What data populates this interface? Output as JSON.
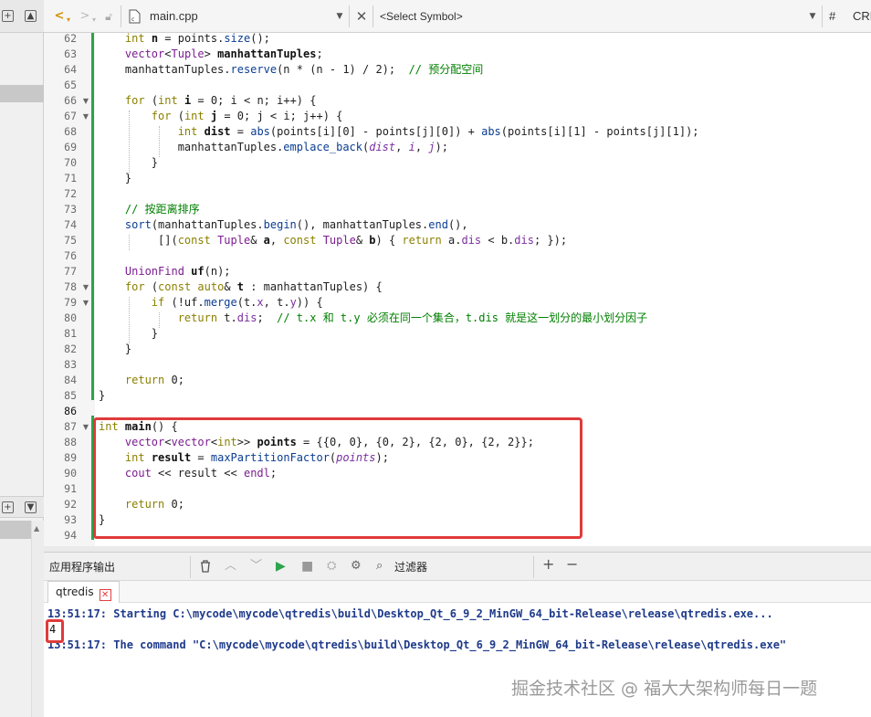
{
  "editor": {
    "file_name": "main.cpp",
    "symbol_placeholder": "<Select Symbol>",
    "hash_label": "#",
    "line_ending": "CRL"
  },
  "code": {
    "lines": [
      {
        "n": "62",
        "html": "    <span class='kw'>int</span> <span class='id'>n</span> = points.<span class='fn'>size</span>();"
      },
      {
        "n": "63",
        "html": "    <span class='ty'>vector</span>&lt;<span class='ty'>Tuple</span>&gt; <span class='id'>manhattanTuples</span>;"
      },
      {
        "n": "64",
        "html": "    manhattanTuples.<span class='fn'>reserve</span>(n * (n - 1) / 2);  <span class='cm'>// 预分配空间</span>"
      },
      {
        "n": "65",
        "html": ""
      },
      {
        "n": "66",
        "html": "    <span class='kw'>for</span> (<span class='kw'>int</span> <span class='id'>i</span> = 0; i &lt; n; i++) {"
      },
      {
        "n": "67",
        "html": "        <span class='kw'>for</span> (<span class='kw'>int</span> <span class='id'>j</span> = 0; j &lt; i; j++) {"
      },
      {
        "n": "68",
        "html": "            <span class='kw'>int</span> <span class='id'>dist</span> = <span class='fn'>abs</span>(points[i][0] - points[j][0]) + <span class='fn'>abs</span>(points[i][1] - points[j][1]);"
      },
      {
        "n": "69",
        "html": "            manhattanTuples.<span class='fn'>emplace_back</span>(<span class='it'>dist</span>, <span class='it'>i</span>, <span class='it'>j</span>);"
      },
      {
        "n": "70",
        "html": "        }"
      },
      {
        "n": "71",
        "html": "    }"
      },
      {
        "n": "72",
        "html": ""
      },
      {
        "n": "73",
        "html": "    <span class='cm'>// 按距离排序</span>"
      },
      {
        "n": "74",
        "html": "    <span class='fn'>sort</span>(manhattanTuples.<span class='fn'>begin</span>(), manhattanTuples.<span class='fn'>end</span>(),"
      },
      {
        "n": "75",
        "html": "         [](<span class='kw'>const</span> <span class='ty'>Tuple</span>&amp; <span class='id'>a</span>, <span class='kw'>const</span> <span class='ty'>Tuple</span>&amp; <span class='id'>b</span>) { <span class='kw'>return</span> a.<span class='pr'>dis</span> &lt; b.<span class='pr'>dis</span>; });"
      },
      {
        "n": "76",
        "html": ""
      },
      {
        "n": "77",
        "html": "    <span class='ty'>UnionFind</span> <span class='id'>uf</span>(n);"
      },
      {
        "n": "78",
        "html": "    <span class='kw'>for</span> (<span class='kw'>const</span> <span class='kw'>auto</span>&amp; <span class='id'>t</span> : manhattanTuples) {"
      },
      {
        "n": "79",
        "html": "        <span class='kw'>if</span> (!uf.<span class='fn'>merge</span>(t.<span class='pr'>x</span>, t.<span class='pr'>y</span>)) {"
      },
      {
        "n": "80",
        "html": "            <span class='kw'>return</span> t.<span class='pr'>dis</span>;  <span class='cm'>// t.x 和 t.y 必须在同一个集合，t.dis 就是这一划分的最小划分因子</span>"
      },
      {
        "n": "81",
        "html": "        }"
      },
      {
        "n": "82",
        "html": "    }"
      },
      {
        "n": "83",
        "html": ""
      },
      {
        "n": "84",
        "html": "    <span class='kw'>return</span> 0;"
      },
      {
        "n": "85",
        "html": "}"
      },
      {
        "n": "86",
        "html": ""
      },
      {
        "n": "87",
        "html": "<span class='kw'>int</span> <span class='id'>main</span>() {"
      },
      {
        "n": "88",
        "html": "    <span class='ty'>vector</span>&lt;<span class='ty'>vector</span>&lt;<span class='kw'>int</span>&gt;&gt; <span class='id'>points</span> = {{0, 0}, {0, 2}, {2, 0}, {2, 2}};"
      },
      {
        "n": "89",
        "html": "    <span class='kw'>int</span> <span class='id'>result</span> = <span class='fn'>maxPartitionFactor</span>(<span class='it'>points</span>);"
      },
      {
        "n": "90",
        "html": "    <span class='ty'>cout</span> &lt;&lt; result &lt;&lt; <span class='ty'>endl</span>;"
      },
      {
        "n": "91",
        "html": ""
      },
      {
        "n": "92",
        "html": "    <span class='kw'>return</span> 0;"
      },
      {
        "n": "93",
        "html": "}"
      },
      {
        "n": "94",
        "html": ""
      }
    ]
  },
  "output": {
    "pane_title": "应用程序输出",
    "filter_label": "过滤器",
    "tab_label": "qtredis",
    "line1": "13:51:17: Starting C:\\mycode\\mycode\\qtredis\\build\\Desktop_Qt_6_9_2_MinGW_64_bit-Release\\release\\qtredis.exe...",
    "result": "4",
    "line2": "13:51:17: The command \"C:\\mycode\\mycode\\qtredis\\build\\Desktop_Qt_6_9_2_MinGW_64_bit-Release\\release\\qtredis.exe\""
  },
  "watermark": "掘金技术社区 @ 福大大架构师每日一题"
}
